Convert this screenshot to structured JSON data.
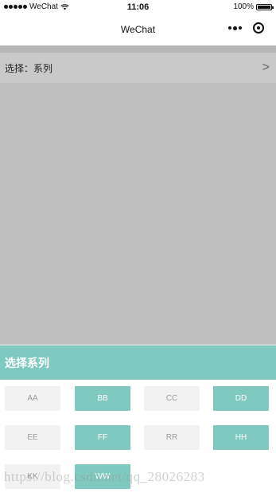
{
  "status_bar": {
    "carrier": "WeChat",
    "time": "11:06",
    "battery": "100%"
  },
  "nav": {
    "title": "WeChat"
  },
  "select_row": {
    "label": "选择：系列",
    "arrow": ">"
  },
  "picker": {
    "title": "选择系列",
    "options": [
      {
        "label": "AA",
        "selected": false
      },
      {
        "label": "BB",
        "selected": true
      },
      {
        "label": "CC",
        "selected": false
      },
      {
        "label": "DD",
        "selected": true
      },
      {
        "label": "EE",
        "selected": false
      },
      {
        "label": "FF",
        "selected": true
      },
      {
        "label": "RR",
        "selected": false
      },
      {
        "label": "HH",
        "selected": true
      },
      {
        "label": "KK",
        "selected": false
      },
      {
        "label": "WW",
        "selected": true
      }
    ]
  },
  "colors": {
    "accent": "#7fc9c0",
    "overlay": "#bfbfbf",
    "option_off": "#f2f2f2"
  },
  "watermark": "https://blog.csdn.net/qq_28026283"
}
